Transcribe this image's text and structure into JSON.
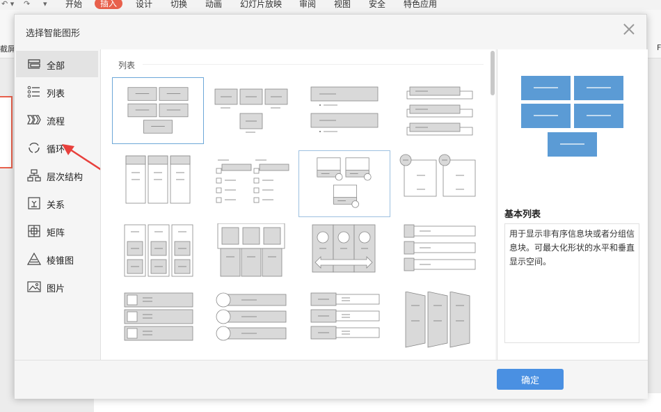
{
  "ribbon": {
    "tabs": [
      "开始",
      "插入",
      "设计",
      "切换",
      "动画",
      "幻灯片放映",
      "审阅",
      "视图",
      "安全",
      "特色应用"
    ],
    "active_tab": "插入",
    "left_label": "截屏",
    "right_label": "F"
  },
  "dialog": {
    "title": "选择智能图形",
    "close_icon": "close-icon"
  },
  "sidebar": {
    "items": [
      {
        "label": "全部",
        "icon": "all-icon"
      },
      {
        "label": "列表",
        "icon": "list-icon"
      },
      {
        "label": "流程",
        "icon": "process-icon"
      },
      {
        "label": "循环",
        "icon": "cycle-icon"
      },
      {
        "label": "层次结构",
        "icon": "hierarchy-icon"
      },
      {
        "label": "关系",
        "icon": "relationship-icon"
      },
      {
        "label": "矩阵",
        "icon": "matrix-icon"
      },
      {
        "label": "棱锥图",
        "icon": "pyramid-icon"
      },
      {
        "label": "图片",
        "icon": "picture-icon"
      }
    ],
    "active_index": 0
  },
  "main": {
    "section_label": "列表",
    "selected_index": 0
  },
  "preview": {
    "title": "基本列表",
    "description": "用于显示非有序信息块或者分组信息块。可最大化形状的水平和垂直显示空间。",
    "accent": "#5b9bd5"
  },
  "footer": {
    "ok_label": "确定"
  },
  "colors": {
    "accent_red": "#e8604c",
    "selection": "#6ca7d8",
    "button": "#4a90e2",
    "shape_fill": "#d9d9d9",
    "shape_stroke": "#888888"
  }
}
